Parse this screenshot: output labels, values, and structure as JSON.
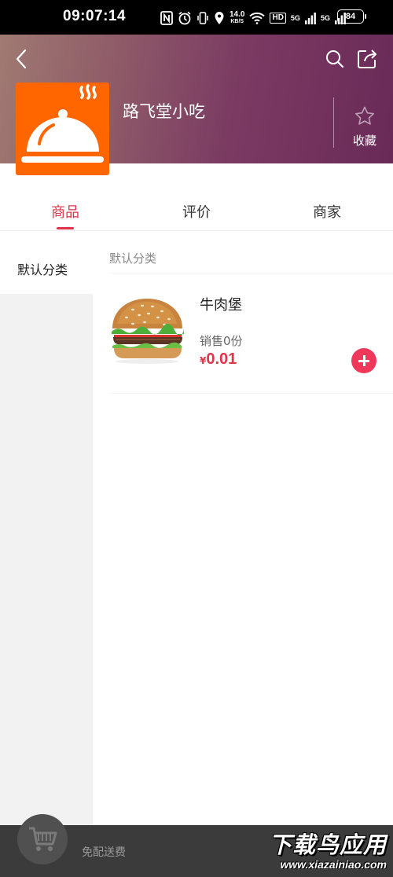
{
  "status_bar": {
    "time": "09:07:14",
    "speed_value": "14.0",
    "speed_unit": "KB/S",
    "hd_label": "HD",
    "network_1": "5G",
    "network_2": "5G",
    "battery": "84"
  },
  "shop": {
    "name": "路飞堂小吃",
    "favorite_label": "收藏"
  },
  "tabs": [
    {
      "label": "商品"
    },
    {
      "label": "评价"
    },
    {
      "label": "商家"
    }
  ],
  "sidebar": {
    "categories": [
      {
        "label": "默认分类"
      }
    ]
  },
  "section": {
    "title": "默认分类"
  },
  "products": [
    {
      "name": "牛肉堡",
      "sales": "销售0份",
      "currency": "¥",
      "price": "0.01"
    }
  ],
  "cart_bar": {
    "delivery_text": "免配送费"
  },
  "watermark": {
    "title": "下载鸟应用",
    "url": "www.xiazainiao.com"
  },
  "colors": {
    "accent": "#e0344a",
    "logo_bg": "#ff6600",
    "cart_bar_bg": "#3b3b3b"
  },
  "icons": [
    "back-icon",
    "search-icon",
    "share-icon",
    "star-icon",
    "cloche-icon",
    "cart-icon",
    "plus-icon"
  ]
}
